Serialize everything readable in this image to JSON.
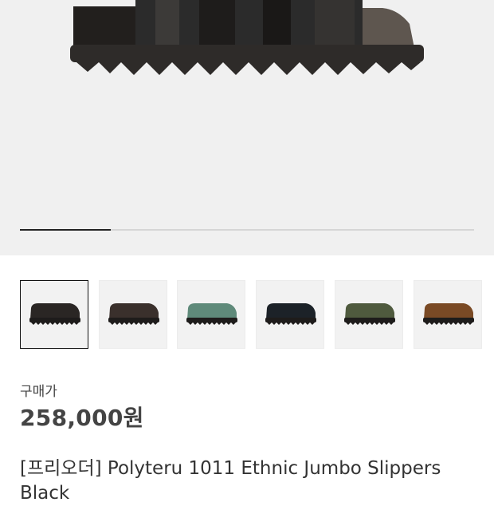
{
  "gallery": {
    "image_alt": "Polyteru 1011 Ethnic Jumbo Slippers - main image",
    "progress_fraction": 0.2,
    "thumbnails": [
      {
        "colorway": "black",
        "color": "#2a2624",
        "selected": true
      },
      {
        "colorway": "dark brown",
        "color": "#3a302c",
        "selected": false
      },
      {
        "colorway": "sage green",
        "color": "#5f8a7a",
        "selected": false
      },
      {
        "colorway": "navy black",
        "color": "#1c2228",
        "selected": false
      },
      {
        "colorway": "olive",
        "color": "#4f5a3e",
        "selected": false
      },
      {
        "colorway": "camel brown",
        "color": "#7a4a25",
        "selected": false
      }
    ]
  },
  "product": {
    "price_label": "구매가",
    "price": "258,000원",
    "title": "[프리오더] Polyteru 1011 Ethnic Jumbo Slippers Black"
  }
}
